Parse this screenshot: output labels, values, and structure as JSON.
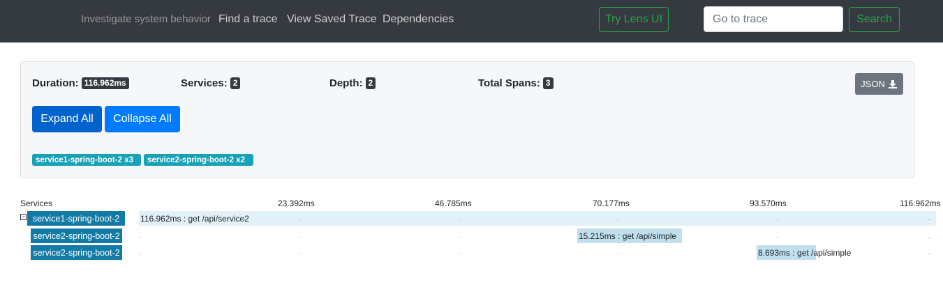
{
  "header": {
    "subtitle": "Investigate system behavior",
    "nav": [
      "Find a trace",
      "View Saved Trace",
      "Dependencies"
    ],
    "lens_button": "Try Lens UI",
    "goto_placeholder": "Go to trace",
    "search_button": "Search"
  },
  "summary": {
    "duration_label": "Duration:",
    "duration_value": "116.962ms",
    "services_label": "Services:",
    "services_value": "2",
    "depth_label": "Depth:",
    "depth_value": "2",
    "spans_label": "Total Spans:",
    "spans_value": "3",
    "json_button": "JSON",
    "expand_all": "Expand All",
    "collapse_all": "Collapse All",
    "service_tags": [
      "service1-spring-boot-2 x3",
      "service2-spring-boot-2 x2"
    ]
  },
  "timeline": {
    "services_header": "Services",
    "ticks": [
      "23.392ms",
      "46.785ms",
      "70.177ms",
      "93.570ms",
      "116.962ms"
    ],
    "rows": [
      {
        "service": "service1-spring-boot-2",
        "label": "116.962ms : get /api/service2"
      },
      {
        "service": "service2-spring-boot-2",
        "label": "15.215ms : get /api/simple"
      },
      {
        "service": "service2-spring-boot-2",
        "label": "8.693ms : get /api/simple"
      }
    ]
  },
  "colors": {
    "navbar": "#343a40",
    "accent_green": "#28a745",
    "primary_blue": "#007bff",
    "service_tag": "#17a2b8",
    "service_label": "#117ba6",
    "span_bar": "#c1e0ee"
  }
}
